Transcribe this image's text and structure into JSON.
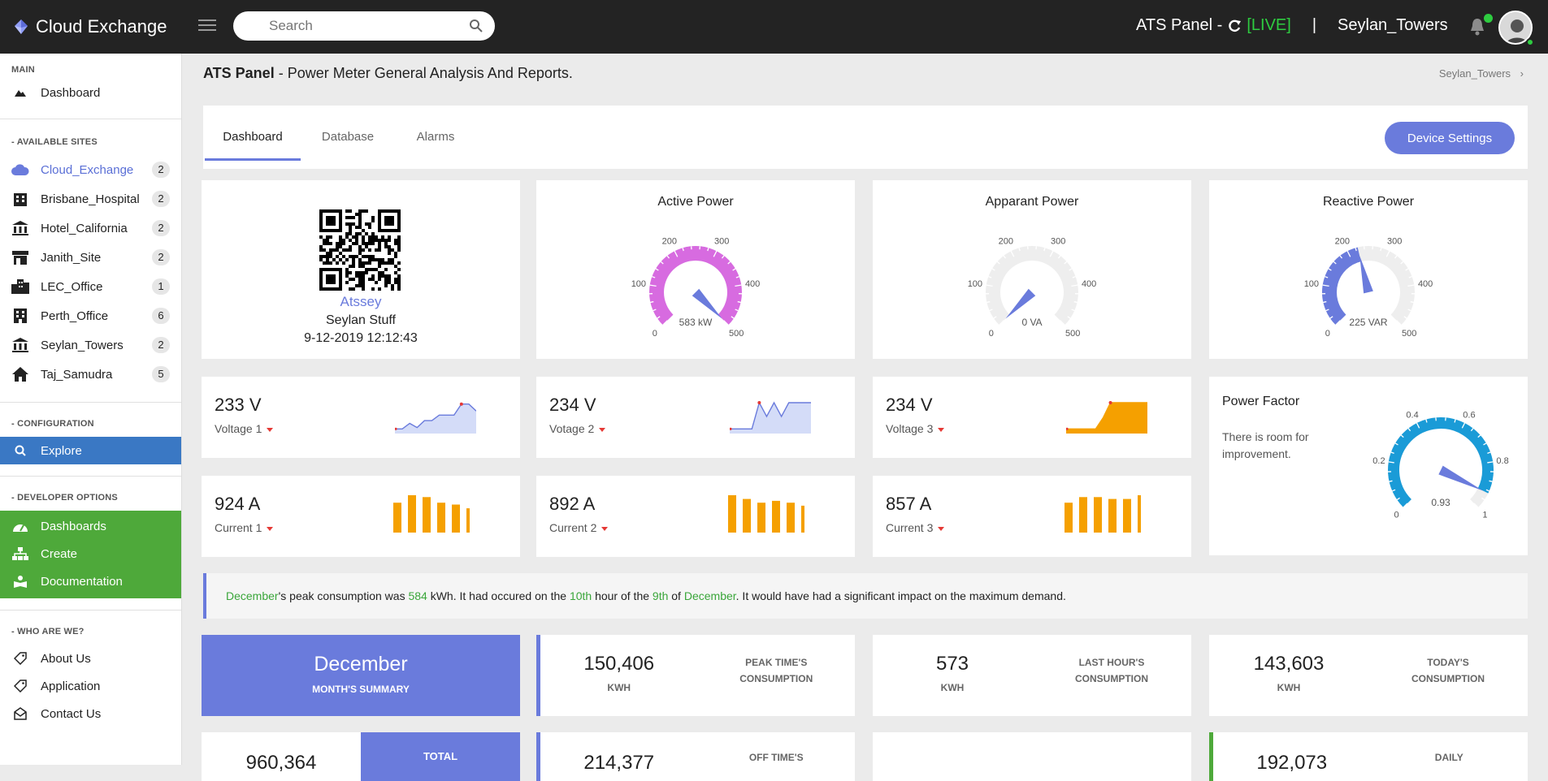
{
  "brand": {
    "name": "Cloud Exchange"
  },
  "search": {
    "placeholder": "Search"
  },
  "topbar": {
    "panel_label": "ATS Panel -",
    "live": "[LIVE]",
    "separator": "|",
    "site": "Seylan_Towers"
  },
  "sidebar": {
    "main_title": "MAIN",
    "dashboard": "Dashboard",
    "sites_title": "- AVAILABLE SITES",
    "sites": [
      {
        "label": "Cloud_Exchange",
        "count": "2",
        "icon": "cloud-icon"
      },
      {
        "label": "Brisbane_Hospital",
        "count": "2",
        "icon": "building-icon"
      },
      {
        "label": "Hotel_California",
        "count": "2",
        "icon": "bank-icon"
      },
      {
        "label": "Janith_Site",
        "count": "2",
        "icon": "store-icon"
      },
      {
        "label": "LEC_Office",
        "count": "1",
        "icon": "city-icon"
      },
      {
        "label": "Perth_Office",
        "count": "6",
        "icon": "building-icon"
      },
      {
        "label": "Seylan_Towers",
        "count": "2",
        "icon": "bank-icon"
      },
      {
        "label": "Taj_Samudra",
        "count": "5",
        "icon": "home-icon"
      }
    ],
    "config_title": "- CONFIGURATION",
    "explore": "Explore",
    "dev_title": "- DEVELOPER OPTIONS",
    "dev_items": [
      "Dashboards",
      "Create",
      "Documentation"
    ],
    "who_title": "- WHO ARE WE?",
    "who_items": [
      "About Us",
      "Application",
      "Contact Us"
    ]
  },
  "page": {
    "title_bold": "ATS Panel",
    "title_rest": " - Power Meter General Analysis And Reports.",
    "breadcrumb": "Seylan_Towers"
  },
  "tabs": [
    "Dashboard",
    "Database",
    "Alarms"
  ],
  "device_settings": "Device Settings",
  "device": {
    "name": "Atssey",
    "owner": "Seylan Stuff",
    "datetime": "9-12-2019 12:12:43"
  },
  "gauges": [
    {
      "title": "Active Power",
      "value": 583,
      "unit": "kW",
      "readout": "583 kW",
      "min": 0,
      "max": 500,
      "ticks": [
        "0",
        "100",
        "200",
        "300",
        "400",
        "500"
      ],
      "color": "#d76be0"
    },
    {
      "title": "Apparant Power",
      "value": 0,
      "unit": "VA",
      "readout": "0 VA",
      "min": 0,
      "max": 500,
      "ticks": [
        "0",
        "100",
        "200",
        "300",
        "400",
        "500"
      ],
      "color": "#6a7bdc"
    },
    {
      "title": "Reactive Power",
      "value": 225,
      "unit": "VAR",
      "readout": "225 VAR",
      "min": 0,
      "max": 500,
      "ticks": [
        "0",
        "100",
        "200",
        "300",
        "400",
        "500"
      ],
      "color": "#6a7bdc"
    }
  ],
  "voltages": [
    {
      "value": "233 V",
      "label": "Voltage 1",
      "color": "#6a7bdc",
      "fill": "#cfd8f7",
      "series": [
        0.05,
        0.05,
        0.25,
        0.1,
        0.35,
        0.35,
        0.55,
        0.55,
        0.55,
        0.95,
        0.95,
        0.7
      ]
    },
    {
      "value": "234 V",
      "label": "Votage 2",
      "color": "#6a7bdc",
      "fill": "#cfd8f7",
      "series": [
        0.05,
        0.05,
        0.05,
        0.05,
        1,
        0.5,
        1,
        0.5,
        1,
        1,
        1,
        1
      ]
    },
    {
      "value": "234 V",
      "label": "Voltage 3",
      "color": "#f5a000",
      "fill": "#f5a000",
      "series": [
        0.05,
        0.05,
        0.05,
        0.05,
        0.05,
        0.45,
        1,
        1,
        1,
        1,
        1,
        1
      ]
    }
  ],
  "currents": [
    {
      "value": "924 A",
      "label": "Current 1",
      "bars": [
        0.8,
        1,
        0.95,
        0.8,
        0.75,
        0.65
      ]
    },
    {
      "value": "892 A",
      "label": "Current 2",
      "bars": [
        1,
        0.9,
        0.8,
        0.85,
        0.8,
        0.72
      ]
    },
    {
      "value": "857 A",
      "label": "Current 3",
      "bars": [
        0.8,
        0.95,
        0.95,
        0.9,
        0.9,
        1
      ]
    }
  ],
  "power_factor": {
    "title": "Power Factor",
    "note": "There is room for improvement.",
    "value": 0.93,
    "readout": "0.93",
    "ticks": [
      "0",
      "0.2",
      "0.4",
      "0.6",
      "0.8",
      "1"
    ],
    "color": "#1a9bd7"
  },
  "alert": {
    "month": "December",
    "t1": "'s peak consumption was ",
    "kwh": "584",
    "t2": " kWh. It had occured on the ",
    "hour": "10th",
    "t3": " hour of the ",
    "day": "9th",
    "t4": " of ",
    "month2": "December",
    "t5": ". It would have had a significant impact on the maximum demand."
  },
  "summary": {
    "month": "December",
    "month_sub": "MONTH'S SUMMARY",
    "cards": [
      {
        "value": "150,406",
        "unit": "KWH",
        "label1": "PEAK TIME'S",
        "label2": "CONSUMPTION"
      },
      {
        "value": "573",
        "unit": "KWH",
        "label1": "LAST HOUR'S",
        "label2": "CONSUMPTION"
      },
      {
        "value": "143,603",
        "unit": "KWH",
        "label1": "TODAY'S",
        "label2": "CONSUMPTION"
      }
    ],
    "row2": {
      "left_value": "960,364",
      "total_label": "TOTAL",
      "off_value": "214,377",
      "off_label": "OFF TIME'S",
      "daily_value": "192,073",
      "daily_label": "DAILY"
    }
  }
}
